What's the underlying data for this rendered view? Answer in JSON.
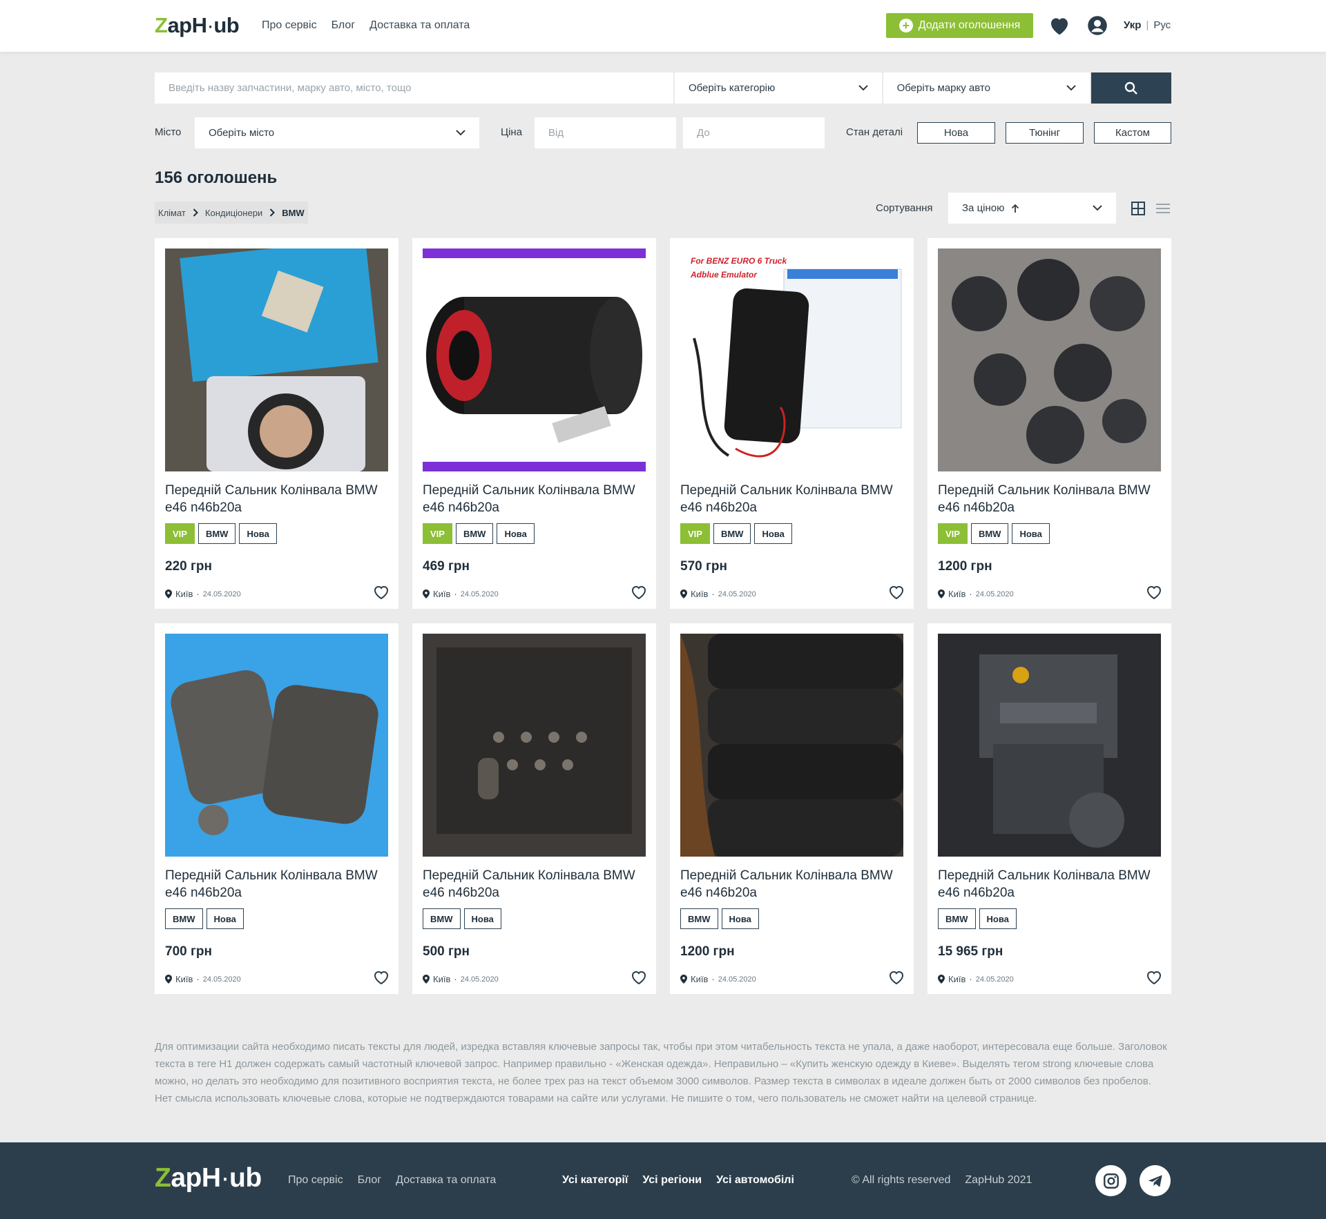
{
  "header": {
    "logo": "ZapHub",
    "nav": [
      "Про сервіс",
      "Блог",
      "Доставка та оплата"
    ],
    "add_button": "Додати оголошення",
    "lang_active": "Укр",
    "lang_other": "Рус"
  },
  "search": {
    "placeholder": "Введіть назву запчастини, марку авто, місто, тощо",
    "category": "Оберіть категорію",
    "brand": "Оберіть марку авто"
  },
  "filters": {
    "city_label": "Місто",
    "city_value": "Оберіть місто",
    "price_label": "Ціна",
    "price_from": "Від",
    "price_to": "До",
    "condition_label": "Стан деталі",
    "conditions": [
      "Нова",
      "Тюнінг",
      "Кастом"
    ]
  },
  "results": {
    "count": "156 оголошень",
    "breadcrumbs": [
      "Клімат",
      "Кондиціонери",
      "BMW"
    ],
    "sort_label": "Сортування",
    "sort_value": "За ціною"
  },
  "cards": [
    {
      "title": "Передній Сальник Колінвала BMW e46 n46b20a",
      "tags": [
        "VIP",
        "BMW",
        "Нова"
      ],
      "price": "220 грн",
      "city": "Київ",
      "date": "24.05.2020",
      "image": "oil-seal-package"
    },
    {
      "title": "Передній Сальник Колінвала BMW e46 n46b20a",
      "tags": [
        "VIP",
        "BMW",
        "Нова"
      ],
      "price": "469 грн",
      "city": "Київ",
      "date": "24.05.2020",
      "image": "subwoofer-tube"
    },
    {
      "title": "Передній Сальник Колінвала BMW e46 n46b20a",
      "tags": [
        "VIP",
        "BMW",
        "Нова"
      ],
      "price": "570 грн",
      "city": "Київ",
      "date": "24.05.2020",
      "image": "adblue-emulator",
      "image_caption_1": "For BENZ EURO 6 Truck",
      "image_caption_2": "Adblue Emulator"
    },
    {
      "title": "Передній Сальник Колінвала BMW e46 n46b20a",
      "tags": [
        "VIP",
        "BMW",
        "Нова"
      ],
      "price": "1200 грн",
      "city": "Київ",
      "date": "24.05.2020",
      "image": "fuel-pumps"
    },
    {
      "title": "Передній Сальник Колінвала BMW e46 n46b20a",
      "tags": [
        "BMW",
        "Нова"
      ],
      "price": "700 грн",
      "city": "Київ",
      "date": "24.05.2020",
      "image": "starters"
    },
    {
      "title": "Передній Сальник Колінвала BMW e46 n46b20a",
      "tags": [
        "BMW",
        "Нова"
      ],
      "price": "500 грн",
      "city": "Київ",
      "date": "24.05.2020",
      "image": "skid-plate"
    },
    {
      "title": "Передній Сальник Колінвала BMW e46 n46b20a",
      "tags": [
        "BMW",
        "Нова"
      ],
      "price": "1200 грн",
      "city": "Київ",
      "date": "24.05.2020",
      "image": "tires"
    },
    {
      "title": "Передній Сальник Колінвала BMW e46 n46b20a",
      "tags": [
        "BMW",
        "Нова"
      ],
      "price": "15 965 грн",
      "city": "Київ",
      "date": "24.05.2020",
      "image": "engine"
    }
  ],
  "seo_text": "Для оптимизации сайта необходимо писать тексты для людей, изредка вставляя ключевые запросы так, чтобы при этом читабельность текста не упала, а даже наоборот, интересовала еще больше. Заголовок текста в теге H1 должен содержать самый частотный ключевой запрос. Например правильно - «Женская одежда». Неправильно – «Купить женскую одежду в Киеве». Выделять тегом strong ключевые слова можно, но делать это необходимо для позитивного восприятия текста, не более трех раз на текст объемом 3000 символов. Размер текста в символах в идеале должен быть от 2000 символов без пробелов. Нет смысла использовать ключевые слова, которые не подтверждаются товарами на сайте или услугами. Не пишите о том, чего пользователь не сможет найти на целевой странице.",
  "footer": {
    "logo": "ZapHub",
    "nav": [
      "Про сервіс",
      "Блог",
      "Доставка та оплата"
    ],
    "nav_bold": [
      "Усі категорії",
      "Усі регіони",
      "Усі автомобілі"
    ],
    "rights": "© All rights reserved",
    "copyright": "ZapHub 2021",
    "social": [
      "instagram-icon",
      "telegram-icon"
    ]
  },
  "colors": {
    "accent": "#8cbf35",
    "dark": "#2c3e4b",
    "button": "#2d4252"
  }
}
